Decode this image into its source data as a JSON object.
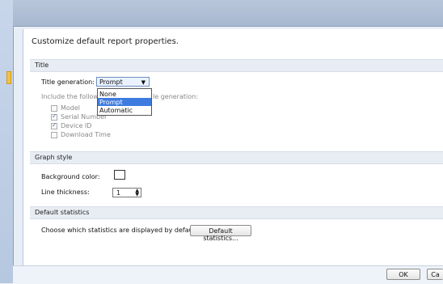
{
  "dialog": {
    "header": "Customize default report properties."
  },
  "title_section": {
    "heading": "Title",
    "generation_label": "Title generation:",
    "selected": "Prompt",
    "options": [
      "None",
      "Prompt",
      "Automatic"
    ],
    "include_text_left": "Include the follow",
    "include_text_right": "le generation:",
    "checkboxes": [
      {
        "label": "Model",
        "checked": false
      },
      {
        "label": "Serial Number",
        "checked": true
      },
      {
        "label": "Device ID",
        "checked": true
      },
      {
        "label": "Download Time",
        "checked": false
      }
    ]
  },
  "graph_section": {
    "heading": "Graph style",
    "background_label": "Background color:",
    "line_label": "Line thickness:",
    "line_value": "1"
  },
  "stats_section": {
    "heading": "Default statistics",
    "text": "Choose which statistics are displayed by default:",
    "button": "Default statistics..."
  },
  "footer": {
    "ok": "OK",
    "cancel_partial": "Ca"
  },
  "colors": {
    "selection_blue": "#3d7be0",
    "frame_blue": "#b8c6da",
    "section_gray": "#e8edf3"
  }
}
